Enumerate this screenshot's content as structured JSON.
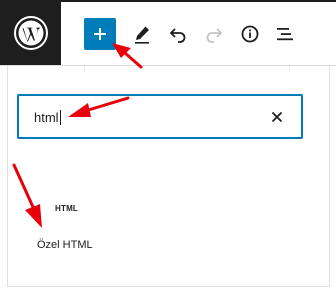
{
  "toolbar": {
    "logo": "wordpress-icon",
    "buttons": [
      {
        "name": "toggle-block-inserter",
        "icon": "plus-icon"
      },
      {
        "name": "tools",
        "icon": "pencil-icon"
      },
      {
        "name": "undo",
        "icon": "undo-icon"
      },
      {
        "name": "redo",
        "icon": "redo-icon"
      },
      {
        "name": "details",
        "icon": "info-icon"
      },
      {
        "name": "document-overview",
        "icon": "list-view-icon"
      }
    ],
    "accent_color": "#007cba"
  },
  "inserter": {
    "search": {
      "value": "html",
      "placeholder": ""
    },
    "clear_icon": "close-icon",
    "results": [
      {
        "icon_label": "HTML",
        "title": "Özel HTML"
      }
    ]
  },
  "annotations": {
    "arrow_color": "#e8000b",
    "arrows": [
      "arrow-to-inserter-button",
      "arrow-to-search-field",
      "arrow-to-html-block"
    ]
  }
}
